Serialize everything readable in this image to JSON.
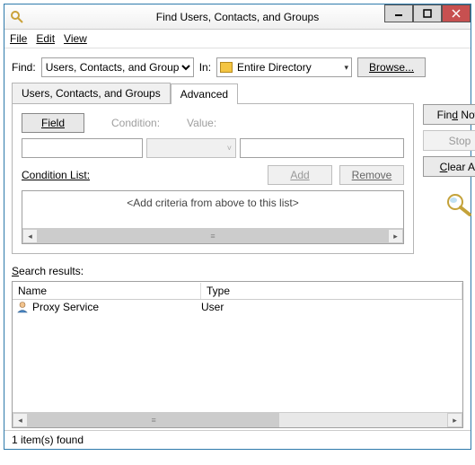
{
  "window": {
    "title": "Find Users, Contacts, and Groups"
  },
  "menu": {
    "file": "File",
    "edit": "Edit",
    "view": "View"
  },
  "searchbar": {
    "find_label": "Find:",
    "find_value": "Users, Contacts, and Groups",
    "in_label": "In:",
    "in_value": "Entire Directory",
    "browse": "Browse..."
  },
  "tabs": {
    "tab1": "Users, Contacts, and Groups",
    "tab2": "Advanced"
  },
  "advanced": {
    "field_btn": "Field",
    "condition_label": "Condition:",
    "value_label": "Value:",
    "condition_list_label": "Condition List:",
    "add_btn": "Add",
    "remove_btn": "Remove",
    "criteria_placeholder": "<Add criteria from above to this list>"
  },
  "side": {
    "find_now": "Find Now",
    "stop": "Stop",
    "clear_all": "Clear All"
  },
  "results": {
    "label": "Search results:",
    "col_name": "Name",
    "col_type": "Type",
    "rows": [
      {
        "name": "Proxy Service",
        "type": "User"
      }
    ]
  },
  "status": {
    "text": "1 item(s) found"
  }
}
